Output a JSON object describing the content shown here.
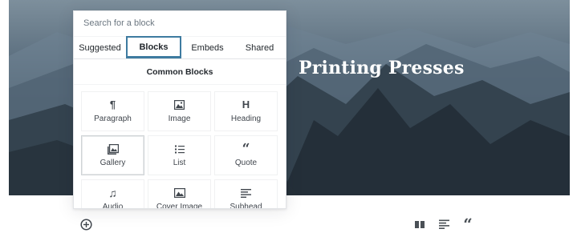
{
  "cover": {
    "title": "Printing Presses"
  },
  "inserter": {
    "search_placeholder": "Search for a block",
    "tabs": [
      {
        "label": "Suggested"
      },
      {
        "label": "Blocks"
      },
      {
        "label": "Embeds"
      },
      {
        "label": "Shared"
      }
    ],
    "active_tab": "Blocks",
    "section_title": "Common Blocks",
    "blocks": [
      {
        "label": "Paragraph",
        "icon": "paragraph-icon"
      },
      {
        "label": "Image",
        "icon": "image-icon"
      },
      {
        "label": "Heading",
        "icon": "heading-icon"
      },
      {
        "label": "Gallery",
        "icon": "gallery-icon"
      },
      {
        "label": "List",
        "icon": "list-icon"
      },
      {
        "label": "Quote",
        "icon": "quote-icon"
      },
      {
        "label": "Audio",
        "icon": "audio-icon"
      },
      {
        "label": "Cover Image",
        "icon": "cover-image-icon"
      },
      {
        "label": "Subhead",
        "icon": "subhead-icon"
      }
    ]
  },
  "footer": {
    "add_block_icon": "plus-circle-icon",
    "quick_icons": [
      "columns-icon",
      "subhead-icon",
      "quote-icon"
    ]
  },
  "colors": {
    "active_tab_border": "#3e7ba0",
    "text": "#23282d"
  }
}
